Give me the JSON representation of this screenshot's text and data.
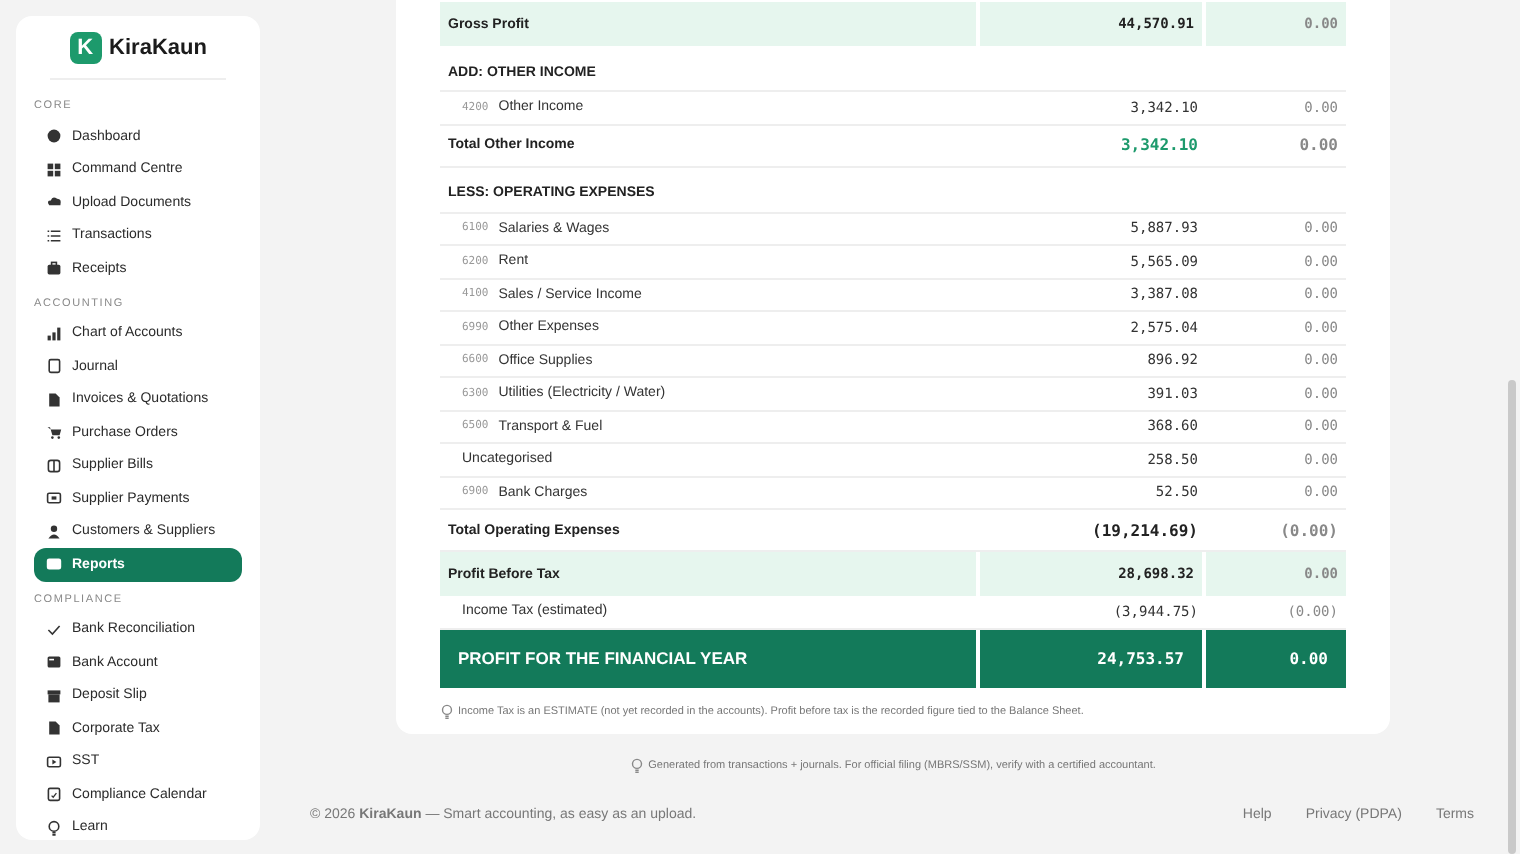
{
  "brand": {
    "logo_letter": "K",
    "name": "KiraKaun"
  },
  "sidebar": {
    "sections": [
      {
        "label": "CORE",
        "items": [
          {
            "label": "Dashboard",
            "selected": false
          },
          {
            "label": "Command Centre",
            "selected": false
          },
          {
            "label": "Upload Documents",
            "selected": false
          },
          {
            "label": "Transactions",
            "selected": false
          },
          {
            "label": "Receipts",
            "selected": false
          }
        ]
      },
      {
        "label": "ACCOUNTING",
        "items": [
          {
            "label": "Chart of Accounts",
            "selected": false
          },
          {
            "label": "Journal",
            "selected": false
          },
          {
            "label": "Invoices & Quotations",
            "selected": false
          },
          {
            "label": "Purchase Orders",
            "selected": false
          },
          {
            "label": "Supplier Bills",
            "selected": false
          },
          {
            "label": "Supplier Payments",
            "selected": false
          },
          {
            "label": "Customers & Suppliers",
            "selected": false
          },
          {
            "label": "Reports",
            "selected": true
          }
        ]
      },
      {
        "label": "COMPLIANCE",
        "items": [
          {
            "label": "Bank Reconciliation",
            "selected": false
          },
          {
            "label": "Bank Account",
            "selected": false
          },
          {
            "label": "Deposit Slip",
            "selected": false
          },
          {
            "label": "Corporate Tax",
            "selected": false
          },
          {
            "label": "SST",
            "selected": false
          },
          {
            "label": "Compliance Calendar",
            "selected": false
          },
          {
            "label": "Learn",
            "selected": false
          }
        ]
      }
    ]
  },
  "report": {
    "rows": [
      {
        "kind": "subtotal",
        "label": "Gross Profit",
        "current": "44,570.91",
        "prior": "0.00"
      },
      {
        "kind": "header",
        "label": "ADD: OTHER INCOME"
      },
      {
        "kind": "account",
        "code": "4200",
        "label": "Other Income",
        "current": "3,342.10",
        "prior": "0.00"
      },
      {
        "kind": "total",
        "label": "Total Other Income",
        "current": "3,342.10",
        "prior": "0.00",
        "accent": true
      },
      {
        "kind": "header",
        "label": "LESS: OPERATING EXPENSES"
      },
      {
        "kind": "account",
        "code": "6100",
        "label": "Salaries & Wages",
        "current": "5,887.93",
        "prior": "0.00"
      },
      {
        "kind": "account",
        "code": "6200",
        "label": "Rent",
        "current": "5,565.09",
        "prior": "0.00"
      },
      {
        "kind": "account",
        "code": "4100",
        "label": "Sales / Service Income",
        "current": "3,387.08",
        "prior": "0.00"
      },
      {
        "kind": "account",
        "code": "6990",
        "label": "Other Expenses",
        "current": "2,575.04",
        "prior": "0.00"
      },
      {
        "kind": "account",
        "code": "6600",
        "label": "Office Supplies",
        "current": "896.92",
        "prior": "0.00"
      },
      {
        "kind": "account",
        "code": "6300",
        "label": "Utilities (Electricity / Water)",
        "current": "391.03",
        "prior": "0.00"
      },
      {
        "kind": "account",
        "code": "6500",
        "label": "Transport & Fuel",
        "current": "368.60",
        "prior": "0.00"
      },
      {
        "kind": "account",
        "label": "Uncategorised",
        "current": "258.50",
        "prior": "0.00"
      },
      {
        "kind": "account",
        "code": "6900",
        "label": "Bank Charges",
        "current": "52.50",
        "prior": "0.00"
      },
      {
        "kind": "total",
        "label": "Total Operating Expenses",
        "current": "(19,214.69)",
        "prior": "(0.00)",
        "accent": false
      },
      {
        "kind": "subtotal",
        "label": "Profit Before Tax",
        "current": "28,698.32",
        "prior": "0.00"
      },
      {
        "kind": "account",
        "label": "Income Tax (estimated)",
        "current": "(3,944.75)",
        "prior": "(0.00)"
      },
      {
        "kind": "net",
        "label": "PROFIT FOR THE FINANCIAL YEAR",
        "current": "24,753.57",
        "prior": "0.00"
      }
    ],
    "note": "Income Tax is an ESTIMATE (not yet recorded in the accounts). Profit before tax is the recorded figure tied to the Balance Sheet."
  },
  "footer": {
    "note": "Generated from transactions + journals. For official filing (MBRS/SSM), verify with a certified accountant.",
    "copyright": "© 2026 **KiraKaun** — Smart accounting, as easy as an upload.",
    "links": [
      "Help",
      "Privacy (PDPA)",
      "Terms"
    ]
  }
}
